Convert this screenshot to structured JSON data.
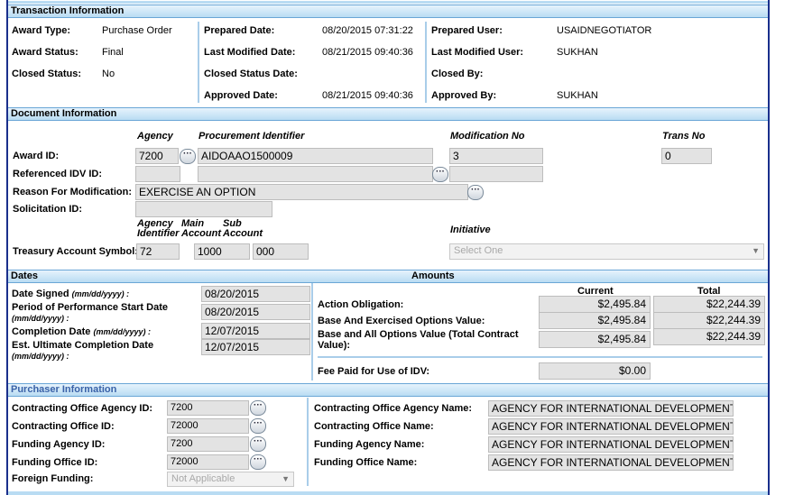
{
  "transaction": {
    "header": "Transaction Information",
    "award_type_label": "Award Type:",
    "award_type": "Purchase Order",
    "award_status_label": "Award Status:",
    "award_status": "Final",
    "closed_status_label": "Closed Status:",
    "closed_status": "No",
    "prepared_date_label": "Prepared Date:",
    "prepared_date": "08/20/2015 07:31:22",
    "last_modified_date_label": "Last Modified Date:",
    "last_modified_date": "08/21/2015 09:40:36",
    "closed_status_date_label": "Closed Status Date:",
    "approved_date_label": "Approved Date:",
    "approved_date": "08/21/2015 09:40:36",
    "prepared_user_label": "Prepared User:",
    "prepared_user": "USAIDNEGOTIATOR",
    "last_modified_user_label": "Last Modified User:",
    "last_modified_user": "SUKHAN",
    "closed_by_label": "Closed By:",
    "approved_by_label": "Approved By:",
    "approved_by": "SUKHAN"
  },
  "document": {
    "header": "Document Information",
    "col_agency": "Agency",
    "col_procurement": "Procurement Identifier",
    "col_modification": "Modification No",
    "col_trans": "Trans No",
    "award_id_label": "Award ID:",
    "award_agency": "7200",
    "award_piid": "AIDOAAO1500009",
    "modification_no": "3",
    "trans_no": "0",
    "ref_idv_label": "Referenced IDV ID:",
    "reason_label": "Reason For Modification:",
    "reason": "EXERCISE AN OPTION",
    "solicitation_label": "Solicitation ID:",
    "agency_identifier_label": "Agency Identifier",
    "main_account_label": "Main Account",
    "sub_account_label": "Sub Account",
    "initiative_label": "Initiative",
    "treasury_label": "Treasury Account Symbol:",
    "treasury_agency": "72",
    "treasury_main": "1000",
    "treasury_sub": "000",
    "initiative_select": "Select One"
  },
  "dates": {
    "header": "Dates",
    "date_signed_label": "Date Signed",
    "date_signed_fmt": "(mm/dd/yyyy) :",
    "date_signed": "08/20/2015",
    "pop_start_label": "Period of Performance Start Date",
    "pop_start_fmt": "(mm/dd/yyyy) :",
    "pop_start": "08/20/2015",
    "completion_label": "Completion Date",
    "completion_fmt": "(mm/dd/yyyy) :",
    "completion": "12/07/2015",
    "ult_completion_label": "Est. Ultimate Completion Date",
    "ult_completion_fmt": "(mm/dd/yyyy) :",
    "ult_completion": "12/07/2015"
  },
  "amounts": {
    "header": "Amounts",
    "col_current": "Current",
    "col_total": "Total",
    "obligation_label": "Action Obligation:",
    "obligation_current": "$2,495.84",
    "obligation_total": "$22,244.39",
    "base_exercised_label": "Base And Exercised Options Value:",
    "base_exercised_current": "$2,495.84",
    "base_exercised_total": "$22,244.39",
    "base_all_label_1": "Base and All Options Value (Total Contract",
    "base_all_label_2": "Value):",
    "base_all_current": "$2,495.84",
    "base_all_total": "$22,244.39",
    "fee_label": "Fee Paid for Use of IDV:",
    "fee": "$0.00"
  },
  "purchaser": {
    "header": "Purchaser Information",
    "co_agency_id_label": "Contracting Office Agency ID:",
    "co_agency_id": "7200",
    "co_id_label": "Contracting Office ID:",
    "co_id": "72000",
    "funding_agency_id_label": "Funding Agency ID:",
    "funding_agency_id": "7200",
    "funding_office_id_label": "Funding Office ID:",
    "funding_office_id": "72000",
    "foreign_funding_label": "Foreign Funding:",
    "foreign_funding": "Not Applicable",
    "co_agency_name_label": "Contracting Office Agency Name:",
    "co_agency_name": "AGENCY FOR INTERNATIONAL DEVELOPMENT",
    "co_name_label": "Contracting Office Name:",
    "co_name": "AGENCY FOR INTERNATIONAL DEVELOPMENT",
    "funding_agency_name_label": "Funding Agency Name:",
    "funding_agency_name": "AGENCY FOR INTERNATIONAL DEVELOPMENT",
    "funding_office_name_label": "Funding Office Name:",
    "funding_office_name": "AGENCY FOR INTERNATIONAL DEVELOPMENT"
  },
  "icons": {
    "lookup": "ellipsis-icon",
    "dropdown": "chevron-down-icon"
  },
  "colors": {
    "frame": "#1a2f8c",
    "header_bg": "#b9dcf3",
    "purchaser_header_text": "#3a62a8"
  }
}
